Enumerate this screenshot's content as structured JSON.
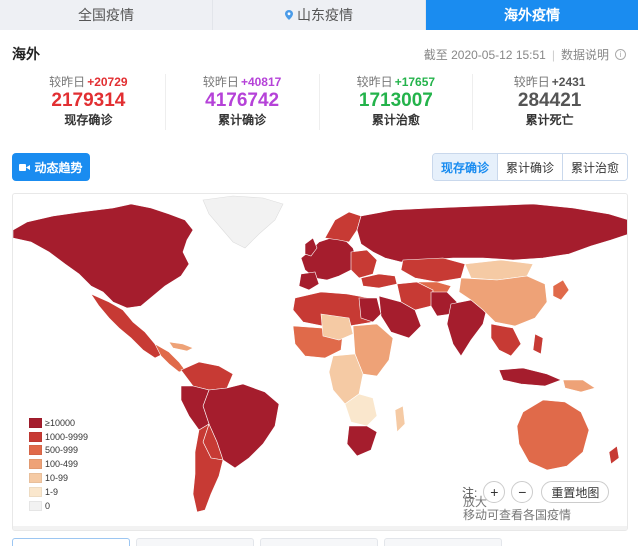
{
  "tabs": [
    {
      "label": "全国疫情"
    },
    {
      "label": "山东疫情",
      "icon": "location-pin-icon"
    },
    {
      "label": "海外疫情",
      "active": true
    }
  ],
  "header": {
    "title": "海外",
    "as_of": "截至 2020-05-12 15:51",
    "data_note": "数据说明"
  },
  "stats": [
    {
      "delta_prefix": "较昨日",
      "delta": "+20729",
      "value": "2179314",
      "label": "现存确诊",
      "color": "#e22f32"
    },
    {
      "delta_prefix": "较昨日",
      "delta": "+40817",
      "value": "4176742",
      "label": "累计确诊",
      "color": "#b542d8"
    },
    {
      "delta_prefix": "较昨日",
      "delta": "+17657",
      "value": "1713007",
      "label": "累计治愈",
      "color": "#24b34b"
    },
    {
      "delta_prefix": "较昨日",
      "delta": "+2431",
      "value": "284421",
      "label": "累计死亡",
      "color": "#555555"
    }
  ],
  "controls": {
    "trend_label": "动态趋势",
    "views": [
      {
        "label": "现存确诊",
        "active": true
      },
      {
        "label": "累计确诊"
      },
      {
        "label": "累计治愈"
      }
    ]
  },
  "map": {
    "legend": [
      {
        "label": "≥10000",
        "color": "#a51d2d"
      },
      {
        "label": "1000-9999",
        "color": "#c73a34"
      },
      {
        "label": "500-999",
        "color": "#e06a4a"
      },
      {
        "label": "100-499",
        "color": "#eea277"
      },
      {
        "label": "10-99",
        "color": "#f5caa4"
      },
      {
        "label": "1-9",
        "color": "#fae7cd"
      },
      {
        "label": "0",
        "color": "#f2f2f2"
      }
    ],
    "note_prefix": "注:",
    "zoom_in": "+",
    "zoom_out": "−",
    "reset_label": "重置地图",
    "note_line1": "放大",
    "note_line2": "移动可查看各国疫情"
  }
}
